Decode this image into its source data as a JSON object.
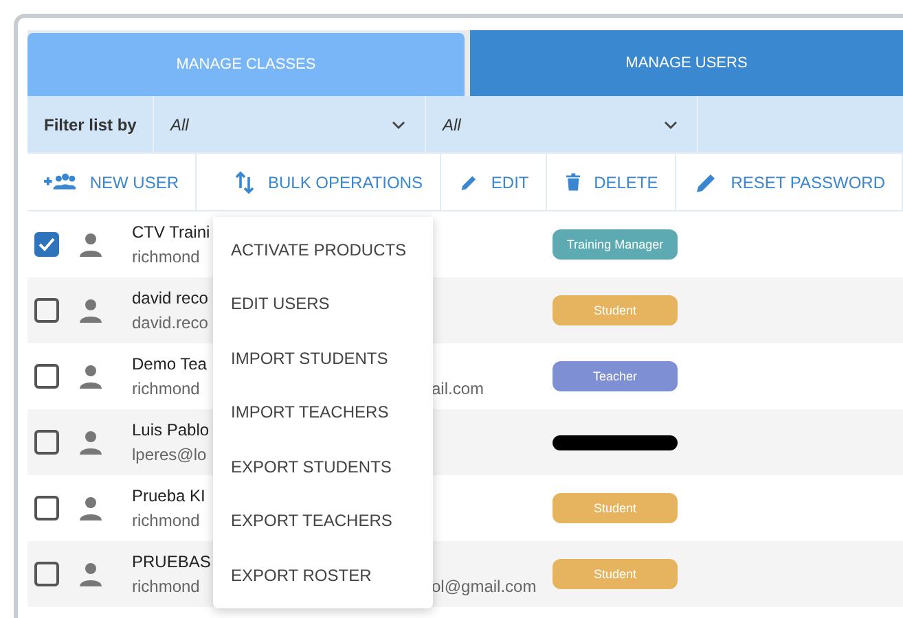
{
  "tabs": [
    {
      "label": "MANAGE CLASSES",
      "selected": false
    },
    {
      "label": "MANAGE USERS",
      "selected": true
    }
  ],
  "filter": {
    "label": "Filter list by",
    "selects": [
      {
        "value": "All"
      },
      {
        "value": "All"
      }
    ]
  },
  "toolbar": [
    {
      "kind": "add-user",
      "label": "NEW USER"
    },
    {
      "kind": "bulk",
      "label": "BULK OPERATIONS"
    },
    {
      "kind": "edit",
      "label": "EDIT"
    },
    {
      "kind": "delete",
      "label": "DELETE"
    },
    {
      "kind": "edit",
      "label": "RESET PASSWORD"
    }
  ],
  "rows": [
    {
      "checked": true,
      "name": "CTV Traini",
      "email": "richmond",
      "role": "Training Manager",
      "color": "#5eaab3"
    },
    {
      "checked": false,
      "name": "david reco",
      "email": "david.reco",
      "role": "Student",
      "color": "#e6b35f"
    },
    {
      "checked": false,
      "name": "Demo Tea",
      "email": "richmond",
      "email_tail": "ail.com",
      "role": "Teacher",
      "color": "#7f8fd3"
    },
    {
      "checked": false,
      "name": "Luis Pablo",
      "email": "lperes@lo",
      "color": "#000000"
    },
    {
      "checked": false,
      "name": "Prueba KI",
      "email": "richmond",
      "role": "Student",
      "color": "#e6b35f"
    },
    {
      "checked": false,
      "name": "PRUEBAS",
      "email": "richmond",
      "email_tail": "ol@gmail.com",
      "role": "Student",
      "color": "#e6b35f"
    }
  ],
  "menu": [
    "ACTIVATE PRODUCTS",
    "EDIT USERS",
    "IMPORT STUDENTS",
    "IMPORT TEACHERS",
    "EXPORT STUDENTS",
    "EXPORT TEACHERS",
    "EXPORT ROSTER"
  ]
}
